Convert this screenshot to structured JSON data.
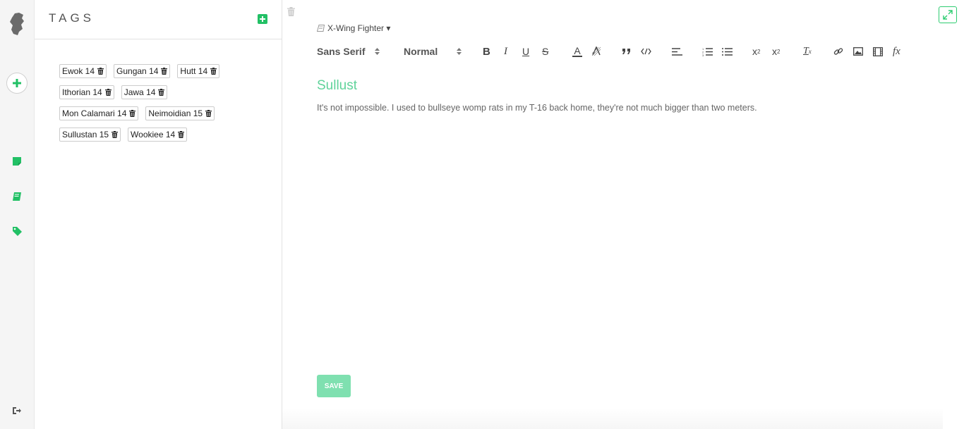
{
  "sidebar": {
    "logo": "rebel-logo-icon",
    "items": [
      {
        "name": "notes",
        "icon": "note-icon"
      },
      {
        "name": "notebooks",
        "icon": "notebook-icon"
      },
      {
        "name": "tags",
        "icon": "tag-icon"
      }
    ],
    "logout_icon": "logout-icon",
    "accent": "#22c065"
  },
  "tags_panel": {
    "title": "TAGS",
    "rows": [
      [
        {
          "label": "Ewok 14"
        },
        {
          "label": "Gungan 14"
        },
        {
          "label": "Hutt 14"
        }
      ],
      [
        {
          "label": "Ithorian 14"
        },
        {
          "label": "Jawa 14"
        }
      ],
      [
        {
          "label": "Mon Calamari 14"
        },
        {
          "label": "Neimoidian 15"
        }
      ],
      [
        {
          "label": "Sullustan 15"
        },
        {
          "label": "Wookiee 14"
        }
      ]
    ]
  },
  "editor": {
    "notebook": "X-Wing Fighter ▾",
    "font_family": "Sans Serif",
    "font_size": "Normal",
    "title": "Sullust",
    "body": "It's not impossible. I used to bullseye womp rats in my T-16 back home, they're not much bigger than two meters.",
    "save_label": "SAVE",
    "toolbar": {
      "bold": "B",
      "italic": "I",
      "underline": "U",
      "strike": "S",
      "color": "A",
      "sub": "x",
      "sub_mark": "2",
      "sup": "x",
      "sup_mark": "2",
      "clean": "T",
      "clean_mark": "x",
      "formula": "fx"
    }
  }
}
